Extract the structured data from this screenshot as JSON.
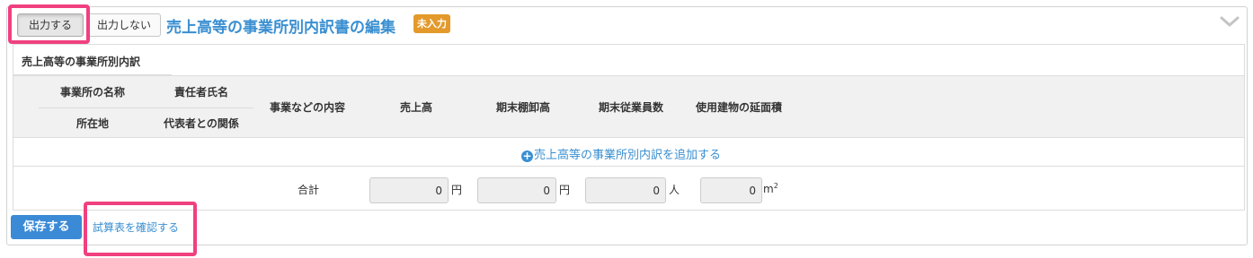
{
  "header": {
    "output_button": "出力する",
    "no_output_button": "出力しない",
    "title": "売上高等の事業所別内訳書の編集",
    "status_badge": "未入力"
  },
  "section": {
    "title": "売上高等の事業所別内訳",
    "columns": {
      "office_name": "事業所の名称",
      "responsible_person": "責任者氏名",
      "location": "所在地",
      "relation": "代表者との関係",
      "business_content": "事業などの内容",
      "sales": "売上高",
      "ending_inventory": "期末棚卸高",
      "ending_employees": "期末従業員数",
      "building_floor_area": "使用建物の延面積"
    },
    "add_link": "売上高等の事業所別内訳を追加する",
    "total": {
      "label": "合計",
      "sales": "0",
      "sales_unit": "円",
      "inventory": "0",
      "inventory_unit": "円",
      "employees": "0",
      "employees_unit": "人",
      "floor_area": "0",
      "floor_area_unit": "m",
      "floor_area_sup": "2"
    }
  },
  "footer": {
    "save_button": "保存する",
    "check_trial_balance_link": "試算表を確認する"
  },
  "colors": {
    "accent": "#3a8fd1",
    "badge": "#e39a2b",
    "highlight": "#f0407f",
    "header_bg": "#f1f1f1"
  }
}
